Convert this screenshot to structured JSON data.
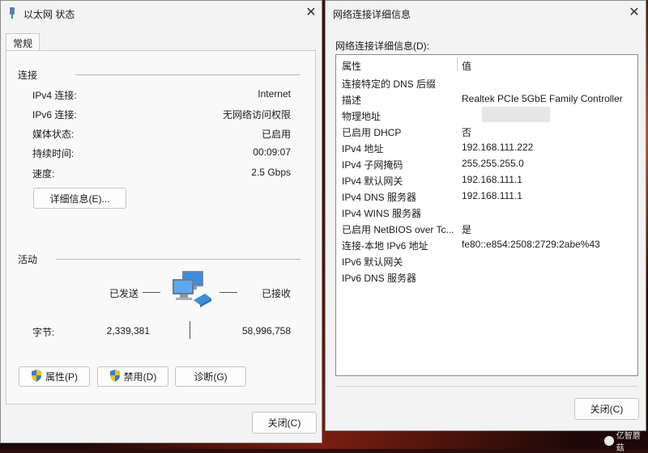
{
  "left_window": {
    "title": "以太网 状态",
    "tab": "常规",
    "connection_section": "连接",
    "rows": [
      {
        "label": "IPv4 连接:",
        "value": "Internet"
      },
      {
        "label": "IPv6 连接:",
        "value": "无网络访问权限"
      },
      {
        "label": "媒体状态:",
        "value": "已启用"
      },
      {
        "label": "持续时间:",
        "value": "00:09:07"
      },
      {
        "label": "速度:",
        "value": "2.5 Gbps"
      }
    ],
    "details_button": "详细信息(E)...",
    "activity_section": "活动",
    "sent_label": "已发送",
    "received_label": "已接收",
    "bytes_label": "字节:",
    "bytes_sent": "2,339,381",
    "bytes_received": "58,996,758",
    "properties_button": "属性(P)",
    "disable_button": "禁用(D)",
    "diagnose_button": "诊断(G)",
    "close_button": "关闭(C)"
  },
  "right_window": {
    "title": "网络连接详细信息",
    "caption": "网络连接详细信息(D):",
    "col_property": "属性",
    "col_value": "值",
    "rows": [
      {
        "property": "连接特定的 DNS 后缀",
        "value": ""
      },
      {
        "property": "描述",
        "value": "Realtek PCIe 5GbE Family Controller"
      },
      {
        "property": "物理地址",
        "value": ""
      },
      {
        "property": "已启用 DHCP",
        "value": "否"
      },
      {
        "property": "IPv4 地址",
        "value": "192.168.111.222"
      },
      {
        "property": "IPv4 子网掩码",
        "value": "255.255.255.0"
      },
      {
        "property": "IPv4 默认网关",
        "value": "192.168.111.1"
      },
      {
        "property": "IPv4 DNS 服务器",
        "value": "192.168.111.1"
      },
      {
        "property": "IPv4 WINS 服务器",
        "value": ""
      },
      {
        "property": "已启用 NetBIOS over Tc...",
        "value": "是"
      },
      {
        "property": "连接-本地 IPv6 地址",
        "value": "fe80::e854:2508:2729:2abe%43"
      },
      {
        "property": "IPv6 默认网关",
        "value": ""
      },
      {
        "property": "IPv6 DNS 服务器",
        "value": ""
      }
    ],
    "close_button": "关闭(C)"
  },
  "watermark": "亿智蘑菇"
}
